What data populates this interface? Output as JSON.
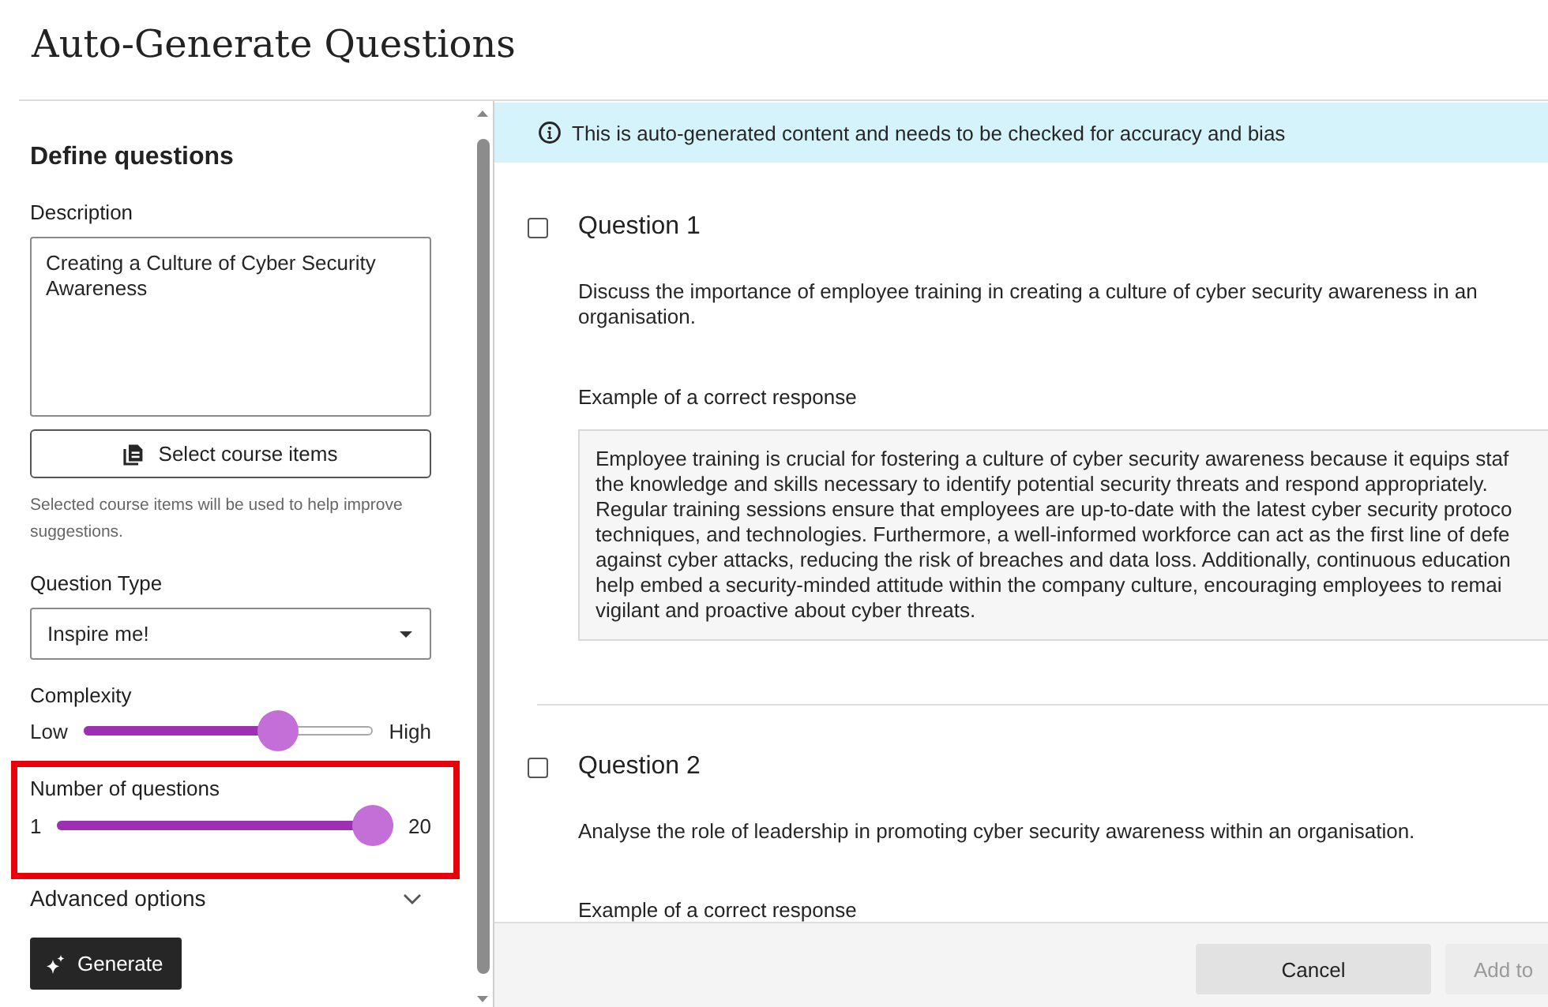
{
  "title": "Auto-Generate Questions",
  "panel": {
    "heading": "Define questions",
    "description": {
      "label": "Description",
      "value": "Creating a Culture of Cyber Security Awareness"
    },
    "select_button": "Select course items",
    "helper_text": "Selected course items will be used to help improve suggestions.",
    "question_type": {
      "label": "Question Type",
      "value": "Inspire me!"
    },
    "sliders": [
      {
        "label": "Complexity",
        "min_label": "Low",
        "max_label": "High",
        "level": 0.7,
        "highlighted": false
      },
      {
        "label": "Number of questions",
        "min_label": "1",
        "max_label": "20",
        "level": 1,
        "highlighted": true
      }
    ],
    "advanced": {
      "label": "Advanced options",
      "expanded": false
    },
    "generate_button": "Generate"
  },
  "notice": "This is auto-generated content and needs to be checked for accuracy and bias",
  "questions": [
    {
      "title": "Question 1",
      "checked": false,
      "text": "Discuss the importance of employee training in creating a culture of cyber security awareness in an organisation.",
      "answer_label": "Example of a correct response",
      "answer_lines": [
        "Employee training is crucial for fostering a culture of cyber security awareness because it equips staf",
        "the knowledge and skills necessary to identify potential security threats and respond appropriately.",
        "Regular training sessions ensure that employees are up-to-date with the latest cyber security protoco",
        "techniques, and technologies. Furthermore, a well-informed workforce can act as the first line of defe",
        "against cyber attacks, reducing the risk of breaches and data loss. Additionally, continuous education",
        "help embed a security-minded attitude within the company culture, encouraging employees to remai",
        "vigilant and proactive about cyber threats."
      ]
    },
    {
      "title": "Question 2",
      "checked": false,
      "text": "Analyse the role of leadership in promoting cyber security awareness within an organisation.",
      "answer_label": "Example of a correct response"
    }
  ],
  "footer": {
    "buttons": [
      {
        "label": "Cancel",
        "disabled": false
      },
      {
        "label": "Add to",
        "disabled": true
      }
    ]
  }
}
